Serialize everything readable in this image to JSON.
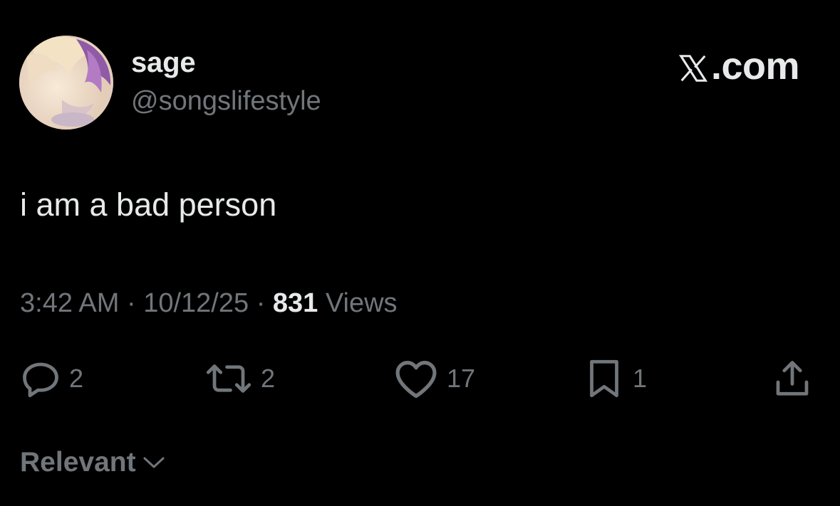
{
  "author": {
    "display_name": "sage",
    "handle": "@songslifestyle"
  },
  "brand": {
    "label": ".com",
    "icon": "x-logo-icon"
  },
  "tweet": {
    "text": "i am a bad person",
    "time": "3:42 AM",
    "separator": "·",
    "date": "10/12/25",
    "views_count": "831",
    "views_label": "Views"
  },
  "actions": {
    "reply": {
      "icon": "reply-icon",
      "count": "2"
    },
    "repost": {
      "icon": "repost-icon",
      "count": "2"
    },
    "like": {
      "icon": "heart-icon",
      "count": "17"
    },
    "bookmark": {
      "icon": "bookmark-icon",
      "count": "1"
    },
    "share": {
      "icon": "share-icon"
    }
  },
  "replies_sort": {
    "label": "Relevant",
    "icon": "chevron-down-icon"
  },
  "colors": {
    "background": "#000000",
    "primary_text": "#e7e9ea",
    "secondary_text": "#71767b"
  }
}
